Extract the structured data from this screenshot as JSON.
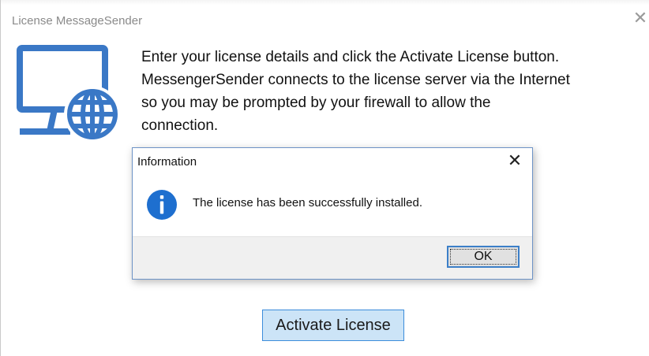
{
  "window": {
    "title": "License MessageSender",
    "close_glyph": "✕",
    "icon": "monitor-globe-icon",
    "icon_color": "#3a78c6"
  },
  "instructions": {
    "lines": [
      "Enter your license details and click the Activate License button.",
      "MessengerSender connects to the license server via the Internet",
      "so you may be prompted by your firewall to allow the",
      "connection."
    ]
  },
  "activate_button": {
    "label": "Activate License"
  },
  "dialog": {
    "title": "Information",
    "close_glyph": "✕",
    "icon": "information-icon",
    "icon_color": "#1e6fcf",
    "message": "The license has been successfully installed.",
    "ok_label": "OK"
  }
}
